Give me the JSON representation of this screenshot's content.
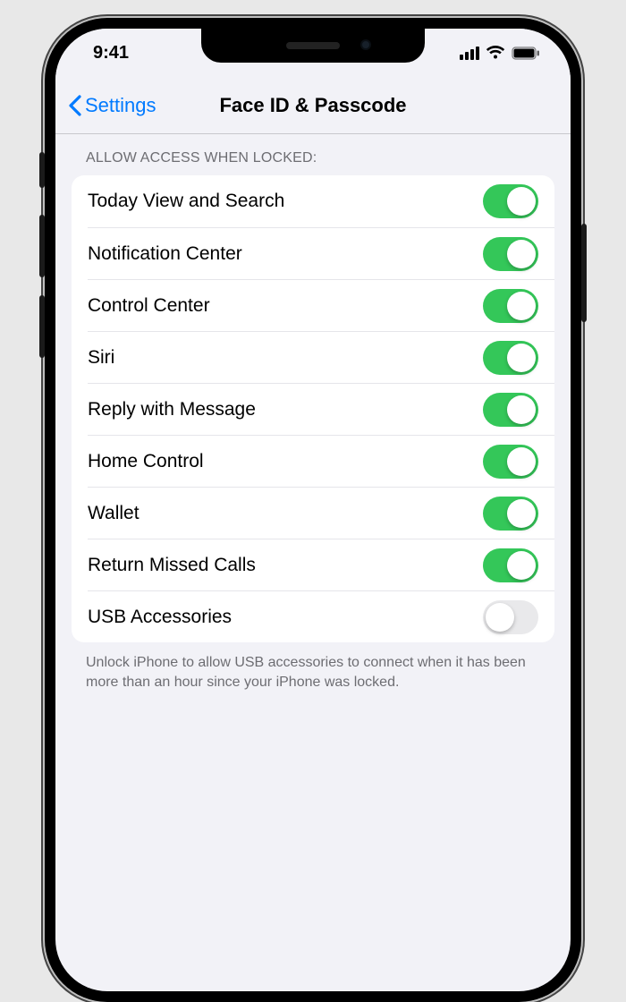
{
  "status": {
    "time": "9:41"
  },
  "nav": {
    "back_label": "Settings",
    "title": "Face ID & Passcode"
  },
  "section": {
    "header": "Allow Access When Locked:",
    "footer": "Unlock iPhone to allow USB accessories to connect when it has been more than an hour since your iPhone was locked.",
    "rows": [
      {
        "label": "Today View and Search",
        "on": true
      },
      {
        "label": "Notification Center",
        "on": true
      },
      {
        "label": "Control Center",
        "on": true
      },
      {
        "label": "Siri",
        "on": true
      },
      {
        "label": "Reply with Message",
        "on": true
      },
      {
        "label": "Home Control",
        "on": true
      },
      {
        "label": "Wallet",
        "on": true
      },
      {
        "label": "Return Missed Calls",
        "on": true
      },
      {
        "label": "USB Accessories",
        "on": false
      }
    ]
  }
}
